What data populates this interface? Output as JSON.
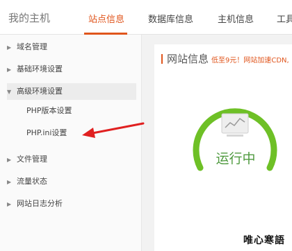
{
  "header": {
    "brand": "我的主机",
    "tabs": [
      {
        "label": "站点信息",
        "active": true
      },
      {
        "label": "数据库信息",
        "active": false
      },
      {
        "label": "主机信息",
        "active": false
      },
      {
        "label": "工具",
        "active": false
      }
    ]
  },
  "sidebar": {
    "items": [
      {
        "label": "域名管理",
        "expanded": false
      },
      {
        "label": "基础环境设置",
        "expanded": false
      },
      {
        "label": "高级环境设置",
        "expanded": true,
        "children": [
          {
            "label": "PHP版本设置"
          },
          {
            "label": "PHP.ini设置"
          }
        ]
      },
      {
        "label": "文件管理",
        "expanded": false
      },
      {
        "label": "流量状态",
        "expanded": false
      },
      {
        "label": "网站日志分析",
        "expanded": false
      }
    ]
  },
  "main": {
    "title": "网站信息",
    "promo": "低至9元！网站加速CDN,",
    "status": "运行中"
  },
  "colors": {
    "accent": "#e0551c",
    "gauge_green": "#6ec026",
    "status_green": "#4f9a3f",
    "arrow_red": "#e02020"
  },
  "icons": {
    "caret_right": "caret-right-icon",
    "caret_down": "caret-down-icon",
    "site_preview": "chart-preview-icon"
  },
  "watermark": "唯心寒語"
}
